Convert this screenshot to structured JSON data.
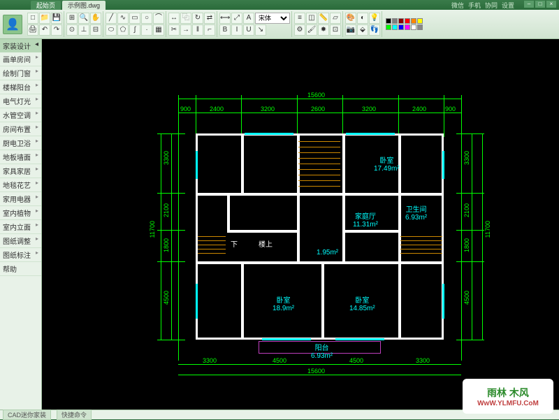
{
  "titlebar": {
    "app": "起始页",
    "tabs": [
      {
        "label": "起始页",
        "active": false
      },
      {
        "label": "示例图.dwg",
        "active": true
      }
    ],
    "right_links": [
      "微信",
      "手机",
      "协同",
      "设置"
    ],
    "win_buttons": [
      "–",
      "□",
      "×"
    ]
  },
  "ribbon": {
    "font": "宋体",
    "bold": "B",
    "italic": "I",
    "underline": "U",
    "colors": [
      "#000000",
      "#7f7f7f",
      "#880000",
      "#ff0000",
      "#ff8800",
      "#ffff00",
      "#00ff00",
      "#00ffff",
      "#0000ff",
      "#ff00ff",
      "#ffffff",
      "#888888"
    ]
  },
  "sidebar": {
    "header": "家装设计",
    "items": [
      "画单房间",
      "绘制门窗",
      "楼梯阳台",
      "电气灯光",
      "水管空调",
      "房间布置",
      "厨电卫浴",
      "地板墙面",
      "家具家居",
      "地毯花艺",
      "家用电器",
      "室内植物",
      "室内立面",
      "图纸调整",
      "图纸标注",
      "帮助"
    ]
  },
  "floorplan": {
    "total_width": "15600",
    "total_height": "11700",
    "top_dims": [
      "900",
      "2400",
      "3200",
      "2600",
      "3200",
      "2400",
      "900"
    ],
    "bottom_dims": [
      "3300",
      "4500",
      "4500",
      "3300"
    ],
    "left_dims": [
      "3300",
      "2100",
      "1800",
      "4500"
    ],
    "right_dims": [
      "3300",
      "2100",
      "1800",
      "4500"
    ],
    "rooms": {
      "bedroom1": {
        "name": "卧室",
        "area": "17.49m²"
      },
      "bathroom": {
        "name": "卫生间",
        "area": "6.93m²"
      },
      "living": {
        "name": "家庭厅",
        "area": "11.31m²"
      },
      "small": {
        "area": "1.95m²"
      },
      "bedroom2": {
        "name": "卧室",
        "area": "18.9m²"
      },
      "bedroom3": {
        "name": "卧室",
        "area": "14.85m²"
      },
      "balcony": {
        "name": "阳台",
        "area": "6.93m²"
      },
      "stair_up": "楼上",
      "stair_down": "下"
    }
  },
  "statusbar": {
    "model_tab": "CAD迷你家装",
    "layout_tab": "快捷命令"
  },
  "watermark": {
    "brand": "雨林 木风",
    "url": "WwW.YLMFU.CoM"
  }
}
